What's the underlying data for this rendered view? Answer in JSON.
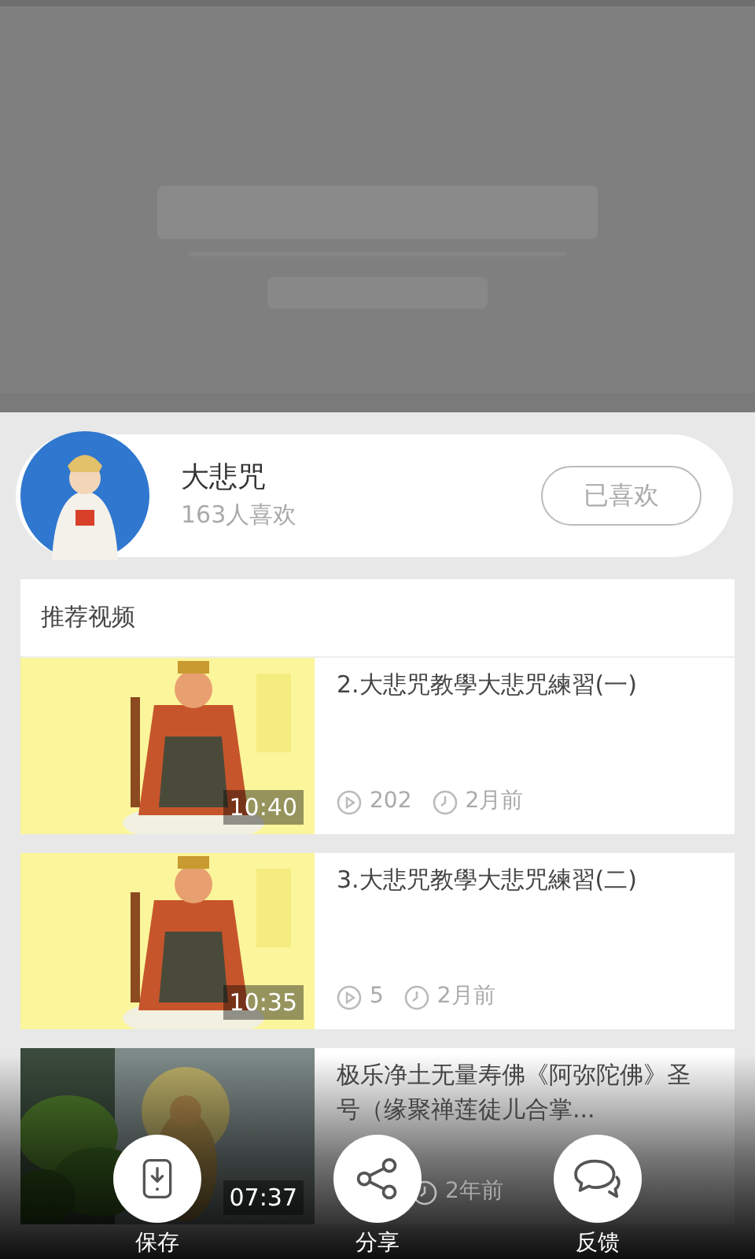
{
  "channel": {
    "name": "大悲咒",
    "likes": "163人喜欢",
    "like_button": {
      "label": "已喜欢",
      "liked": true
    }
  },
  "recommended": {
    "title": "推荐视频",
    "videos": [
      {
        "kind": "picture",
        "title": "2.大悲咒教學大悲咒練習(一)",
        "duration": "10:40",
        "views": "202",
        "age": "2月前"
      },
      {
        "kind": "picture",
        "title": "3.大悲咒教學大悲咒練習(二)",
        "duration": "10:35",
        "views": "5",
        "age": "2月前"
      },
      {
        "kind": "picture",
        "title": "极乐净土无量寿佛《阿弥陀佛》圣号（缘聚禅莲徒儿合掌...",
        "duration": "07:37",
        "age": "2年前"
      }
    ]
  },
  "actions": [
    {
      "kind": "save",
      "label": "保存"
    },
    {
      "kind": "share",
      "label": "分享"
    },
    {
      "kind": "feedback",
      "label": "反馈"
    }
  ]
}
